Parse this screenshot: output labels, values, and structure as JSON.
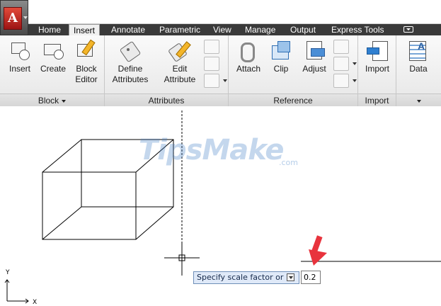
{
  "app": {
    "logo_letter": "A"
  },
  "tabs": [
    {
      "label": "Home"
    },
    {
      "label": "Insert"
    },
    {
      "label": "Annotate"
    },
    {
      "label": "Parametric"
    },
    {
      "label": "View"
    },
    {
      "label": "Manage"
    },
    {
      "label": "Output"
    },
    {
      "label": "Express Tools"
    }
  ],
  "active_tab": "Insert",
  "ribbon": {
    "block": {
      "title": "Block",
      "insert": "Insert",
      "create": "Create",
      "block_editor_1": "Block",
      "block_editor_2": "Editor"
    },
    "attributes": {
      "title": "Attributes",
      "define_1": "Define",
      "define_2": "Attributes",
      "edit_1": "Edit",
      "edit_2": "Attribute"
    },
    "reference": {
      "title": "Reference",
      "attach": "Attach",
      "clip": "Clip",
      "adjust": "Adjust"
    },
    "import": {
      "title": "Import",
      "import": "Import"
    },
    "data": {
      "data": "Data"
    }
  },
  "canvas": {
    "watermark": "TipsMake",
    "watermark_suffix": ".com",
    "prompt": "Specify scale factor or",
    "input_value": "0.2",
    "ucs_y": "Y",
    "ucs_x": "X"
  },
  "colors": {
    "tab_bar": "#3a3a3a",
    "arrow": "#e8333d",
    "prompt_bg": "#dfe9f8"
  }
}
